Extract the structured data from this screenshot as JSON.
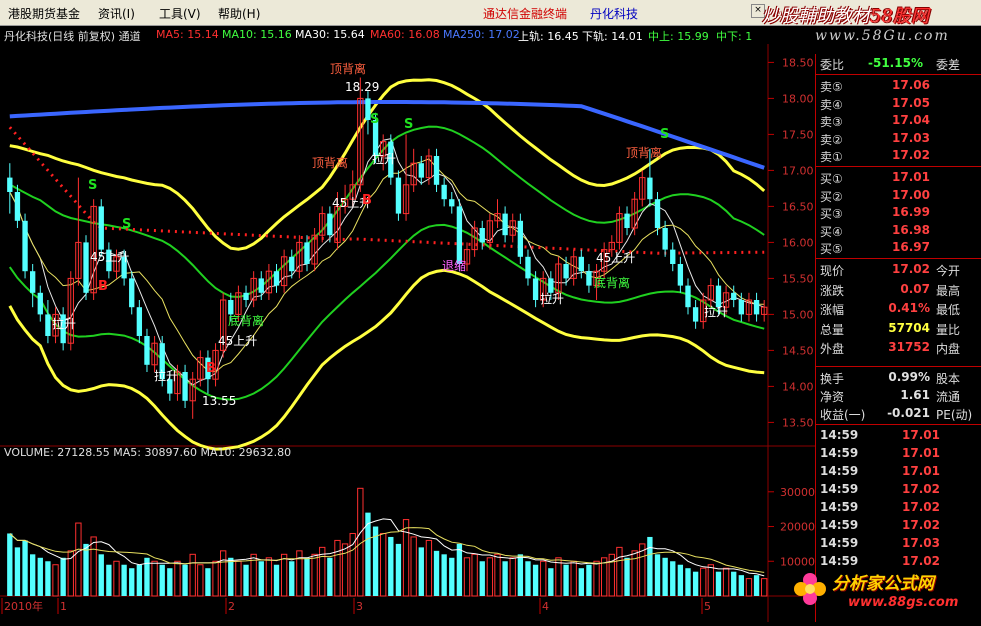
{
  "menu": {
    "items": [
      "港股期货基金",
      "资讯(I)",
      "工具(V)",
      "帮助(H)"
    ],
    "center_red": "通达信金融终端",
    "center_blue": "丹化科技",
    "watermark_a": "炒股輔助教材",
    "watermark_b": "58股网",
    "site": "www.58Gu.com"
  },
  "info": {
    "title": "丹化科技(日线 前复权) 通道",
    "ma5": "MA5: 15.14",
    "ma10": "MA10: 15.16",
    "ma30": "MA30: 15.64",
    "ma60": "MA60: 16.08",
    "ma250": "MA250: 17.02",
    "upper": "上轨: 16.45",
    "lower": "下轨: 14.01",
    "mid_upper": "中上: 15.99",
    "mid_lower": "中下: 1"
  },
  "colors": {
    "up": "#ff3030",
    "down": "#54ffff",
    "yellow": "#ffff40",
    "green": "#20d020",
    "blue": "#3a66ff",
    "red_dot": "#ff2020",
    "grid": "#8b0000"
  },
  "chart_data": {
    "type": "candlestick",
    "price_axis": {
      "ticks": [
        "18.50",
        "18.00",
        "17.50",
        "17.00",
        "16.50",
        "16.00",
        "15.50",
        "15.00",
        "14.50",
        "14.00",
        "13.50"
      ],
      "ylim": [
        13.2,
        18.7
      ]
    },
    "volume_axis": {
      "ticks": [
        "30000",
        "20000",
        "10000"
      ],
      "ylim": [
        0,
        38000
      ]
    },
    "volume_title": "VOLUME: 27128.55  MA5: 30897.60  MA10: 29632.80",
    "x_labels": [
      "2010年",
      "1",
      "2",
      "3",
      "4",
      "5"
    ],
    "annotations": [
      {
        "text": "顶背离",
        "color": "#ff6040"
      },
      {
        "text": "18.29",
        "color": "#ffffff"
      },
      {
        "text": "顶背离",
        "color": "#ff6040"
      },
      {
        "text": "顶背离",
        "color": "#ff6040"
      },
      {
        "text": "底背离",
        "color": "#40ff40"
      },
      {
        "text": "底背离",
        "color": "#40ff40"
      },
      {
        "text": "45上升",
        "color": "#ffffff"
      },
      {
        "text": "45上升",
        "color": "#ffffff"
      },
      {
        "text": "45上升",
        "color": "#ffffff"
      },
      {
        "text": "45上升",
        "color": "#ffffff"
      },
      {
        "text": "拉升",
        "color": "#ffffff"
      },
      {
        "text": "拉升",
        "color": "#ffffff"
      },
      {
        "text": "拉升",
        "color": "#ffffff"
      },
      {
        "text": "拉升",
        "color": "#ffffff"
      },
      {
        "text": "拉升",
        "color": "#ffffff"
      },
      {
        "text": "13.55",
        "color": "#ffffff"
      },
      {
        "text": "退缩",
        "color": "#ff60ff"
      },
      {
        "text": "S",
        "color": "#20e020"
      },
      {
        "text": "S",
        "color": "#20e020"
      },
      {
        "text": "S",
        "color": "#20e020"
      },
      {
        "text": "S",
        "color": "#20e020"
      },
      {
        "text": "S",
        "color": "#20e020"
      },
      {
        "text": "B",
        "color": "#ff2020"
      },
      {
        "text": "B",
        "color": "#ff2020"
      },
      {
        "text": "B",
        "color": "#ff2020"
      }
    ],
    "candles": [
      [
        16.9,
        16.7,
        17.1,
        16.4
      ],
      [
        16.7,
        16.3,
        16.8,
        16.2
      ],
      [
        16.3,
        15.6,
        16.4,
        15.5
      ],
      [
        15.6,
        15.3,
        15.7,
        15.1
      ],
      [
        15.3,
        15.0,
        15.4,
        14.9
      ],
      [
        15.0,
        14.7,
        15.2,
        14.6
      ],
      [
        14.7,
        15.0,
        15.1,
        14.6
      ],
      [
        15.0,
        14.6,
        15.1,
        14.5
      ],
      [
        14.6,
        15.5,
        15.6,
        14.5
      ],
      [
        15.5,
        16.0,
        16.9,
        15.4
      ],
      [
        16.0,
        15.3,
        16.1,
        15.2
      ],
      [
        15.3,
        16.5,
        16.6,
        15.2
      ],
      [
        16.5,
        15.9,
        16.6,
        15.8
      ],
      [
        15.9,
        15.6,
        16.0,
        15.5
      ],
      [
        15.6,
        15.8,
        15.9,
        15.5
      ],
      [
        15.8,
        15.5,
        15.9,
        15.4
      ],
      [
        15.5,
        15.1,
        15.6,
        15.0
      ],
      [
        15.1,
        14.7,
        15.2,
        14.6
      ],
      [
        14.7,
        14.3,
        14.8,
        14.2
      ],
      [
        14.3,
        14.6,
        14.7,
        14.2
      ],
      [
        14.6,
        14.1,
        14.7,
        14.0
      ],
      [
        14.1,
        13.9,
        14.2,
        13.8
      ],
      [
        13.9,
        14.2,
        14.3,
        13.8
      ],
      [
        14.2,
        13.8,
        14.3,
        13.7
      ],
      [
        13.8,
        14.1,
        14.2,
        13.55
      ],
      [
        14.1,
        14.4,
        14.5,
        14.0
      ],
      [
        14.4,
        14.1,
        14.5,
        13.9
      ],
      [
        14.1,
        14.5,
        14.6,
        14.0
      ],
      [
        14.5,
        15.2,
        15.3,
        14.4
      ],
      [
        15.2,
        15.0,
        15.3,
        14.9
      ],
      [
        15.0,
        15.3,
        15.4,
        14.9
      ],
      [
        15.3,
        15.2,
        15.4,
        15.1
      ],
      [
        15.2,
        15.5,
        15.6,
        15.1
      ],
      [
        15.5,
        15.3,
        15.6,
        15.2
      ],
      [
        15.3,
        15.6,
        15.7,
        15.2
      ],
      [
        15.6,
        15.4,
        15.7,
        15.3
      ],
      [
        15.4,
        15.8,
        15.9,
        15.3
      ],
      [
        15.8,
        15.6,
        15.9,
        15.5
      ],
      [
        15.6,
        16.0,
        16.1,
        15.5
      ],
      [
        16.0,
        15.7,
        16.1,
        15.6
      ],
      [
        15.7,
        16.1,
        16.2,
        15.6
      ],
      [
        16.1,
        16.4,
        16.5,
        16.0
      ],
      [
        16.4,
        16.1,
        16.5,
        16.0
      ],
      [
        16.0,
        16.5,
        16.7,
        15.9
      ],
      [
        16.5,
        16.6,
        16.8,
        16.4
      ],
      [
        16.6,
        16.8,
        17.0,
        16.5
      ],
      [
        16.8,
        18.0,
        18.29,
        16.7
      ],
      [
        18.0,
        17.7,
        18.1,
        17.5
      ],
      [
        17.7,
        17.2,
        17.8,
        17.1
      ],
      [
        17.2,
        17.4,
        17.5,
        17.0
      ],
      [
        17.4,
        16.9,
        17.5,
        16.8
      ],
      [
        16.9,
        16.4,
        17.0,
        16.3
      ],
      [
        16.4,
        16.8,
        17.5,
        16.3
      ],
      [
        16.8,
        17.1,
        17.3,
        16.7
      ],
      [
        17.1,
        16.9,
        17.2,
        16.8
      ],
      [
        16.9,
        17.2,
        17.3,
        16.8
      ],
      [
        17.2,
        16.8,
        17.3,
        16.7
      ],
      [
        16.8,
        16.6,
        16.9,
        16.5
      ],
      [
        16.6,
        16.5,
        16.7,
        16.4
      ],
      [
        16.5,
        15.7,
        16.6,
        15.6
      ],
      [
        15.7,
        15.9,
        16.0,
        15.6
      ],
      [
        15.9,
        16.2,
        16.3,
        15.8
      ],
      [
        16.2,
        16.0,
        16.3,
        15.9
      ],
      [
        16.0,
        16.3,
        16.4,
        15.9
      ],
      [
        16.3,
        16.4,
        16.6,
        16.2
      ],
      [
        16.4,
        16.1,
        16.5,
        16.0
      ],
      [
        16.1,
        16.3,
        16.4,
        16.0
      ],
      [
        16.3,
        15.8,
        16.4,
        15.7
      ],
      [
        15.8,
        15.5,
        15.9,
        15.4
      ],
      [
        15.5,
        15.2,
        15.6,
        15.1
      ],
      [
        15.2,
        15.5,
        15.6,
        15.1
      ],
      [
        15.5,
        15.3,
        15.6,
        15.2
      ],
      [
        15.3,
        15.7,
        15.8,
        15.2
      ],
      [
        15.7,
        15.5,
        15.8,
        15.4
      ],
      [
        15.5,
        15.8,
        15.9,
        15.4
      ],
      [
        15.8,
        15.6,
        15.9,
        15.5
      ],
      [
        15.6,
        15.4,
        15.7,
        15.3
      ],
      [
        15.4,
        15.6,
        15.7,
        15.2
      ],
      [
        15.6,
        15.9,
        16.0,
        15.5
      ],
      [
        15.9,
        16.0,
        16.1,
        15.8
      ],
      [
        16.0,
        16.4,
        16.5,
        15.9
      ],
      [
        16.4,
        16.2,
        16.5,
        16.1
      ],
      [
        16.2,
        16.6,
        16.7,
        16.1
      ],
      [
        16.6,
        16.9,
        17.0,
        16.5
      ],
      [
        16.9,
        16.6,
        17.3,
        16.5
      ],
      [
        16.6,
        16.2,
        16.7,
        16.1
      ],
      [
        16.2,
        15.9,
        16.3,
        15.8
      ],
      [
        15.9,
        15.7,
        16.0,
        15.6
      ],
      [
        15.7,
        15.4,
        15.8,
        15.3
      ],
      [
        15.4,
        15.1,
        15.5,
        15.0
      ],
      [
        15.1,
        14.9,
        15.2,
        14.8
      ],
      [
        14.9,
        15.2,
        15.3,
        14.8
      ],
      [
        15.2,
        15.4,
        15.5,
        15.1
      ],
      [
        15.4,
        15.1,
        15.5,
        15.0
      ],
      [
        15.1,
        15.3,
        15.4,
        15.0
      ],
      [
        15.3,
        15.2,
        15.4,
        15.1
      ],
      [
        15.2,
        15.0,
        15.3,
        14.9
      ],
      [
        15.0,
        15.2,
        15.3,
        14.9
      ],
      [
        15.2,
        15.0,
        15.3,
        14.9
      ],
      [
        15.0,
        15.1,
        15.2,
        14.9
      ]
    ],
    "volumes": [
      18000,
      14000,
      16000,
      12000,
      11000,
      10000,
      9000,
      11000,
      13000,
      21000,
      15000,
      17000,
      12000,
      9000,
      10000,
      9000,
      8000,
      9000,
      11000,
      10000,
      9000,
      8000,
      10000,
      9000,
      12000,
      9000,
      8000,
      10000,
      13000,
      11000,
      10000,
      9000,
      12000,
      10000,
      11000,
      9000,
      12000,
      10000,
      13000,
      11000,
      12000,
      14000,
      11000,
      16000,
      15000,
      18000,
      31000,
      24000,
      20000,
      18000,
      17000,
      15000,
      22000,
      17000,
      14000,
      16000,
      13000,
      12000,
      11000,
      15000,
      11000,
      12000,
      10000,
      11000,
      12000,
      10000,
      11000,
      12000,
      10000,
      9000,
      10000,
      8000,
      11000,
      9000,
      10000,
      8000,
      9000,
      10000,
      11000,
      12000,
      14000,
      11000,
      13000,
      15000,
      17000,
      12000,
      11000,
      10000,
      9000,
      8000,
      7000,
      8000,
      9000,
      7000,
      8000,
      7000,
      6000,
      5000,
      6000,
      5000
    ]
  },
  "quote": {
    "weibi_label": "委比",
    "weibi_val": "-51.15%",
    "weicha_label": "委差",
    "sell": [
      {
        "label": "卖⑤",
        "price": "17.06"
      },
      {
        "label": "卖④",
        "price": "17.05"
      },
      {
        "label": "卖③",
        "price": "17.04"
      },
      {
        "label": "卖②",
        "price": "17.03"
      },
      {
        "label": "卖①",
        "price": "17.02"
      }
    ],
    "buy": [
      {
        "label": "买①",
        "price": "17.01"
      },
      {
        "label": "买②",
        "price": "17.00"
      },
      {
        "label": "买③",
        "price": "16.99"
      },
      {
        "label": "买④",
        "price": "16.98"
      },
      {
        "label": "买⑤",
        "price": "16.97"
      }
    ],
    "stats": [
      {
        "l": "现价",
        "v": "17.02",
        "r": "今开",
        "c": "#ff4040"
      },
      {
        "l": "涨跌",
        "v": "0.07",
        "r": "最高",
        "c": "#ff4040"
      },
      {
        "l": "涨幅",
        "v": "0.41%",
        "r": "最低",
        "c": "#ff4040"
      },
      {
        "l": "总量",
        "v": "57704",
        "r": "量比",
        "c": "#ffff40"
      },
      {
        "l": "外盘",
        "v": "31752",
        "r": "内盘",
        "c": "#ff4040"
      }
    ],
    "stats2": [
      {
        "l": "换手",
        "v": "0.99%",
        "r": "股本"
      },
      {
        "l": "净资",
        "v": "1.61",
        "r": "流通"
      },
      {
        "l": "收益(一)",
        "v": "-0.021",
        "r": "PE(动)"
      }
    ],
    "ticks": [
      {
        "t": "14:59",
        "p": "17.01"
      },
      {
        "t": "14:59",
        "p": "17.01"
      },
      {
        "t": "14:59",
        "p": "17.01"
      },
      {
        "t": "14:59",
        "p": "17.02"
      },
      {
        "t": "14:59",
        "p": "17.02"
      },
      {
        "t": "14:59",
        "p": "17.02"
      },
      {
        "t": "14:59",
        "p": "17.03"
      },
      {
        "t": "14:59",
        "p": "17.02"
      }
    ]
  },
  "logo": {
    "text": "分析家公式网",
    "url": "www.88gs.com"
  }
}
